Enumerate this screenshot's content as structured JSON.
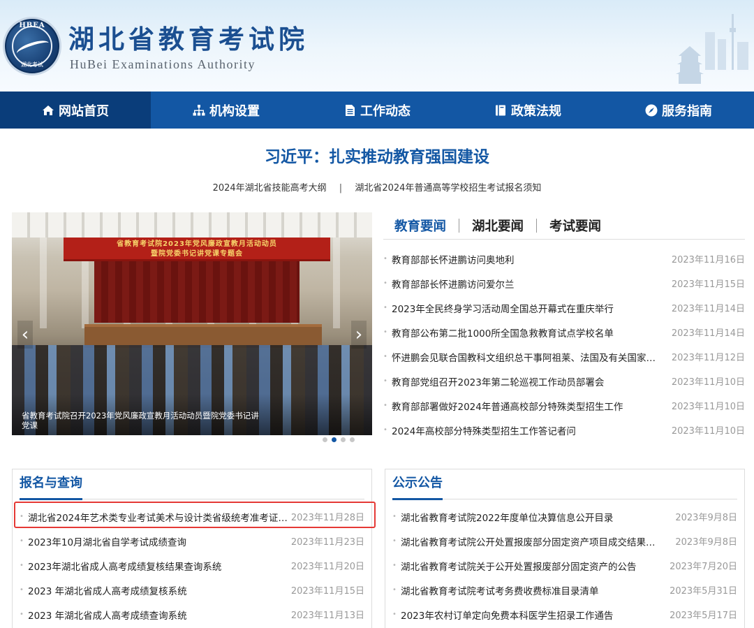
{
  "header": {
    "title": "湖北省教育考试院",
    "subtitle": "HuBei Examinations Authority",
    "logo_top": "HBEA",
    "logo_bottom": "湖北考试"
  },
  "nav": {
    "items": [
      {
        "label": "网站首页",
        "icon": "home-icon"
      },
      {
        "label": "机构设置",
        "icon": "org-chart-icon"
      },
      {
        "label": "工作动态",
        "icon": "document-icon"
      },
      {
        "label": "政策法规",
        "icon": "book-icon"
      },
      {
        "label": "服务指南",
        "icon": "compass-icon"
      }
    ]
  },
  "headline": "习近平：扎实推动教育强国建设",
  "sublinks": {
    "left": "2024年湖北省技能高考大纲",
    "sep": "|",
    "right": "湖北省2024年普通高等学校招生考试报名须知"
  },
  "slider": {
    "banner_line1": "省教育考试院2023年党风廉政宣教月活动动员",
    "banner_line2": "暨院党委书记讲党课专题会",
    "caption": "省教育考试院召开2023年党风廉政宣教月活动动员暨院党委书记讲党课",
    "prev": "‹",
    "next": "›",
    "active_dot": 2
  },
  "news": {
    "tabs": [
      "教育要闻",
      "湖北要闻",
      "考试要闻"
    ],
    "items": [
      {
        "title": "教育部部长怀进鹏访问奥地利",
        "date": "2023年11月16日"
      },
      {
        "title": "教育部部长怀进鹏访问爱尔兰",
        "date": "2023年11月15日"
      },
      {
        "title": "2023年全民终身学习活动周全国总开幕式在重庆举行",
        "date": "2023年11月14日"
      },
      {
        "title": "教育部公布第二批1000所全国急救教育试点学校名单",
        "date": "2023年11月14日"
      },
      {
        "title": "怀进鹏会见联合国教科文组织总干事阿祖莱、法国及有关国家…",
        "date": "2023年11月12日"
      },
      {
        "title": "教育部党组召开2023年第二轮巡视工作动员部署会",
        "date": "2023年11月10日"
      },
      {
        "title": "教育部部署做好2024年普通高校部分特殊类型招生工作",
        "date": "2023年11月10日"
      },
      {
        "title": "2024年高校部分特殊类型招生工作答记者问",
        "date": "2023年11月10日"
      }
    ]
  },
  "registration": {
    "title": "报名与查询",
    "items": [
      {
        "title": "湖北省2024年艺术类专业考试美术与设计类省级统考准考证…",
        "date": "2023年11月28日"
      },
      {
        "title": "2023年10月湖北省自学考试成绩查询",
        "date": "2023年11月23日"
      },
      {
        "title": "2023年湖北省成人高考成绩复核结果查询系统",
        "date": "2023年11月20日"
      },
      {
        "title": "2023 年湖北省成人高考成绩复核系统",
        "date": "2023年11月15日"
      },
      {
        "title": "2023 年湖北省成人高考成绩查询系统",
        "date": "2023年11月13日"
      }
    ]
  },
  "announcements": {
    "title": "公示公告",
    "items": [
      {
        "title": "湖北省教育考试院2022年度单位决算信息公开目录",
        "date": "2023年9月8日"
      },
      {
        "title": "湖北省教育考试院公开处置报废部分固定资产项目成交结果…",
        "date": "2023年9月8日"
      },
      {
        "title": "湖北省教育考试院关于公开处置报废部分固定资产的公告",
        "date": "2023年7月20日"
      },
      {
        "title": "湖北省教育考试院考试考务费收费标准目录清单",
        "date": "2023年5月31日"
      },
      {
        "title": "2023年农村订单定向免费本科医学生招录工作通告",
        "date": "2023年5月17日"
      }
    ]
  },
  "colors": {
    "brand_blue": "#1357a4",
    "nav_active": "#0a3d7a",
    "highlight_red": "#e53935"
  }
}
